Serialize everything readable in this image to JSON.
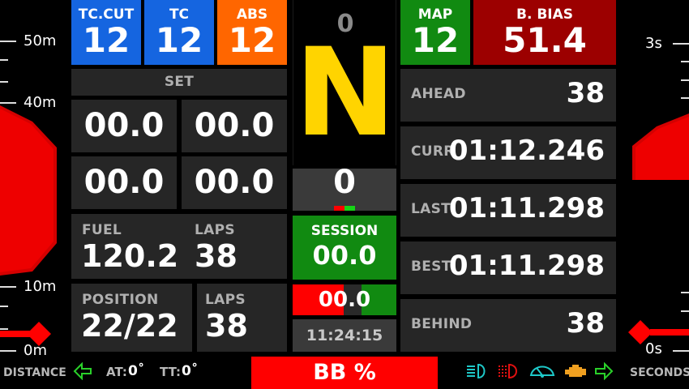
{
  "colors": {
    "blue": "#1565e0",
    "orange": "#ff6600",
    "green": "#118a11",
    "dark_red": "#9c0000",
    "red": "#ff0000",
    "gear_yellow": "#ffd400",
    "panel": "#262626"
  },
  "tiles": {
    "tc_cut": {
      "label": "TC.CUT",
      "value": "12"
    },
    "tc": {
      "label": "TC",
      "value": "12"
    },
    "abs": {
      "label": "ABS",
      "value": "12"
    },
    "map": {
      "label": "MAP",
      "value": "12"
    },
    "brake_bias": {
      "label": "B. BIAS",
      "value": "51.4"
    }
  },
  "set_panel": {
    "header": "SET",
    "values": [
      "00.0",
      "00.0",
      "00.0",
      "00.0"
    ]
  },
  "fuel": {
    "label": "FUEL",
    "value": "120.2",
    "laps_label": "LAPS",
    "laps_value": "38"
  },
  "position": {
    "label": "POSITION",
    "value": "22/22",
    "laps_label": "LAPS",
    "laps_value": "38"
  },
  "gear": {
    "above": "0",
    "current": "N",
    "speed": "0"
  },
  "session": {
    "label": "SESSION",
    "value": "00.0"
  },
  "delta": {
    "value": "00.0"
  },
  "clock": "11:24:15",
  "timing": {
    "ahead": {
      "label": "AHEAD",
      "value": "38"
    },
    "curr": {
      "label": "CURR",
      "value": "01:12.246"
    },
    "last": {
      "label": "LAST",
      "value": "01:11.298"
    },
    "best": {
      "label": "BEST",
      "value": "01:11.298"
    },
    "behind": {
      "label": "BEHIND",
      "value": "38"
    }
  },
  "left_scale": {
    "labels": [
      "50m",
      "40m",
      "10m",
      "0m"
    ],
    "caption": "DISTANCE"
  },
  "right_scale": {
    "labels": [
      "3s",
      "0s"
    ],
    "caption": "SECONDS"
  },
  "bottom": {
    "at_label": "AT:",
    "at_value": "0˚",
    "tt_label": "TT:",
    "tt_value": "0˚",
    "bb_label": "BB %"
  },
  "icons": [
    "left-arrow-icon",
    "headlight-icon",
    "rear-light-icon",
    "wiper-icon",
    "engine-icon",
    "right-arrow-icon"
  ]
}
